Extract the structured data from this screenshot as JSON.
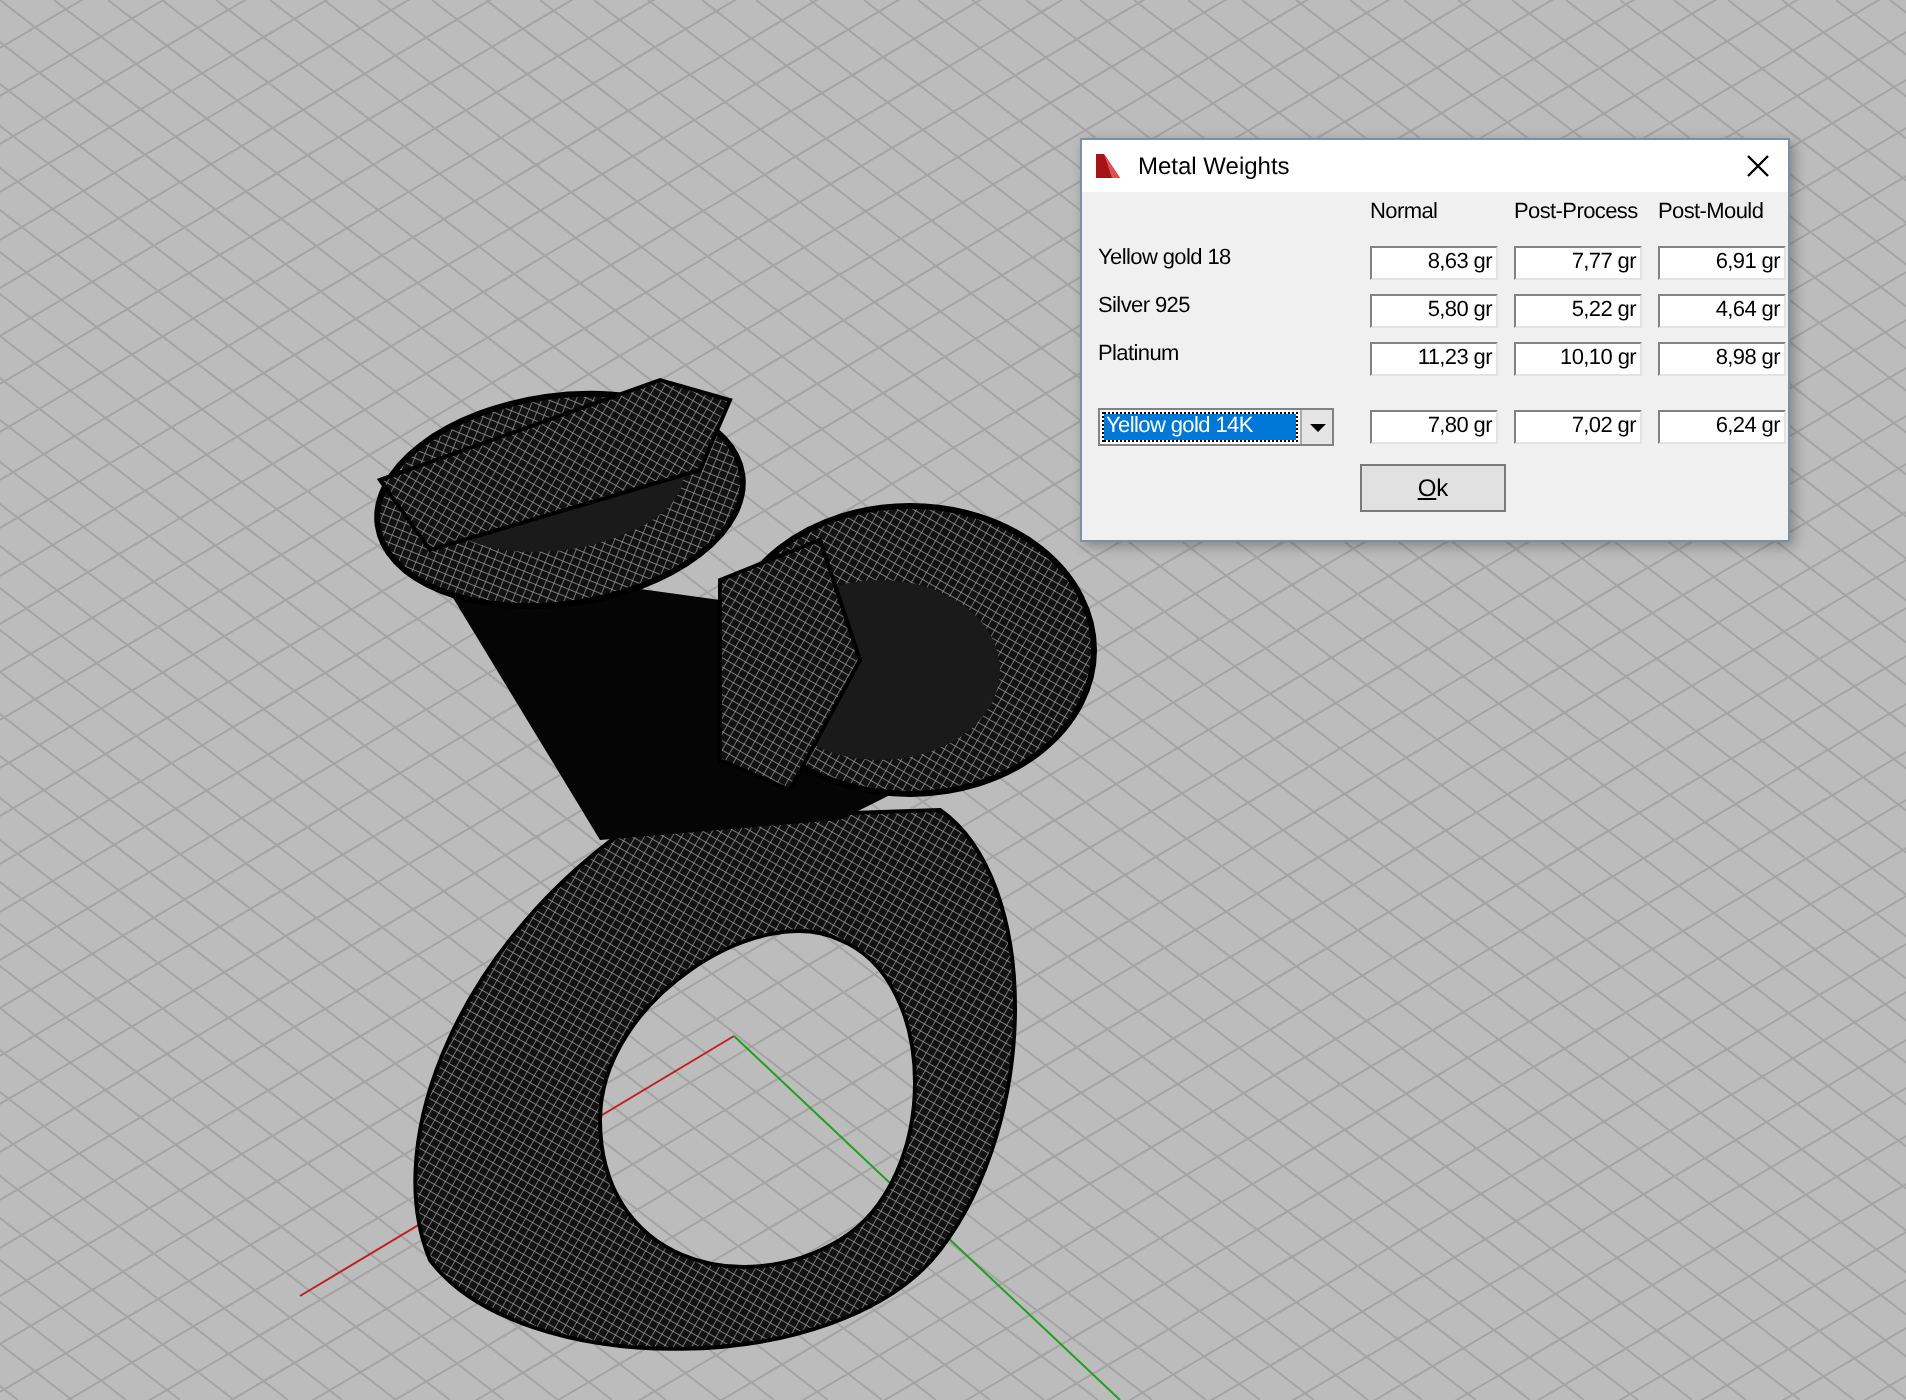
{
  "dialog": {
    "title": "Metal Weights",
    "columns": [
      "Normal",
      "Post-Process",
      "Post-Mould"
    ],
    "rows": [
      {
        "kind": "label",
        "metal": "Yellow gold 18",
        "values": [
          "8,63 gr",
          "7,77 gr",
          "6,91 gr"
        ]
      },
      {
        "kind": "label",
        "metal": "Silver 925",
        "values": [
          "5,80 gr",
          "5,22 gr",
          "4,64 gr"
        ]
      },
      {
        "kind": "label",
        "metal": "Platinum",
        "values": [
          "11,23 gr",
          "10,10 gr",
          "8,98 gr"
        ]
      },
      {
        "kind": "dropdown",
        "metal": "Yellow gold 14K",
        "values": [
          "7,80 gr",
          "7,02 gr",
          "6,24 gr"
        ]
      }
    ],
    "ok_button": "Ok"
  }
}
